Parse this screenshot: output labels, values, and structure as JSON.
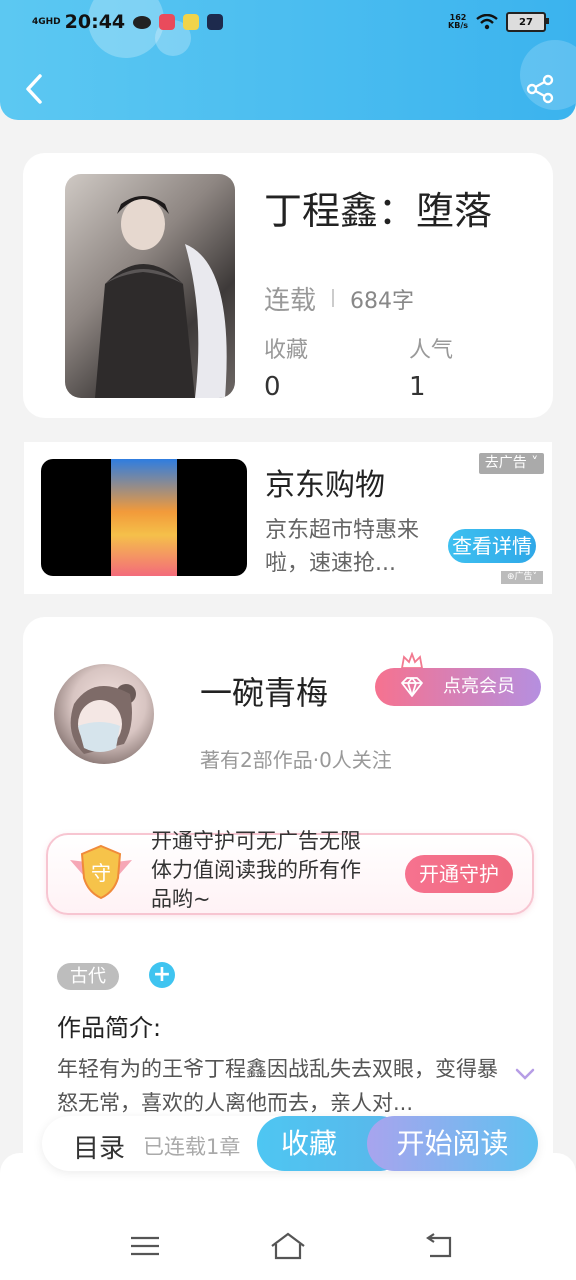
{
  "status_bar": {
    "network": "4GHD",
    "time": "20:44",
    "net_rate": "162",
    "net_rate_unit": "KB/s",
    "battery": "27"
  },
  "book": {
    "title": "丁程鑫：堕落",
    "status": "连载",
    "word_count": "684字",
    "favorites_label": "收藏",
    "favorites_value": "0",
    "popularity_label": "人气",
    "popularity_value": "1"
  },
  "ad": {
    "title": "京东购物",
    "description": "京东超市特惠来啦，速速抢...",
    "close_label": "去广告",
    "button_label": "查看详情",
    "mark": "广告"
  },
  "author": {
    "name": "一碗青梅",
    "meta": "著有2部作品·0人关注",
    "vip_button": "点亮会员"
  },
  "guard": {
    "badge": "守",
    "text": "开通守护可无广告无限体力值阅读我的所有作品哟~",
    "button": "开通守护"
  },
  "tags": {
    "items": [
      "古代"
    ],
    "add": "+"
  },
  "intro": {
    "heading": "作品简介:",
    "text": "年轻有为的王爷丁程鑫因战乱失去双眼，变得暴怒无常，喜欢的人离他而去，亲人对..."
  },
  "bottom_bar": {
    "toc": "目录",
    "chapters": "已连载1章",
    "favorite": "收藏",
    "start_reading": "开始阅读"
  },
  "icons": [
    "back-icon",
    "share-icon",
    "diamond-icon",
    "crown-icon",
    "shield-icon",
    "chevron-down-icon",
    "menu-icon",
    "home-icon",
    "return-icon"
  ]
}
